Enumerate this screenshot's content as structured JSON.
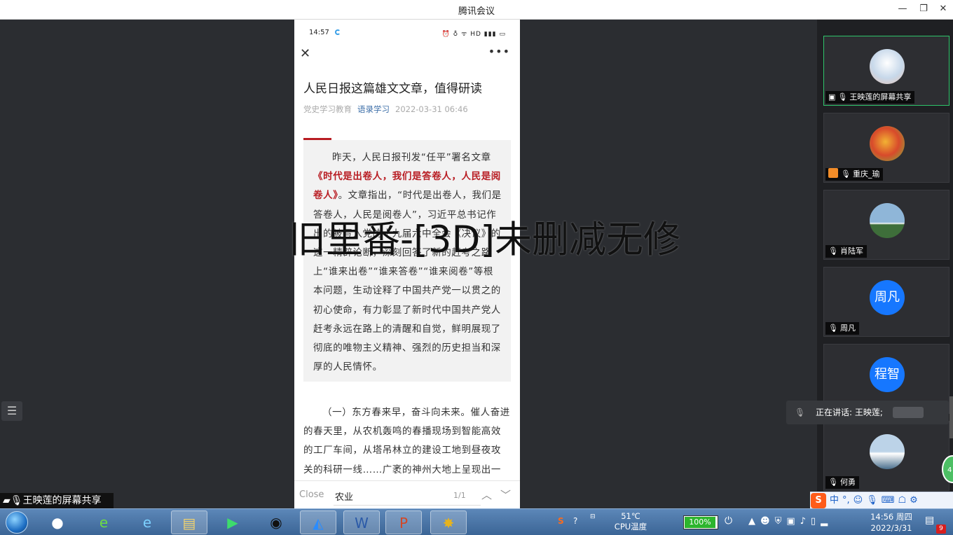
{
  "window": {
    "title": "腾讯会议"
  },
  "phone": {
    "status_time": "14:57",
    "status_icons": "⏰ ♁ ᯤ HD ▮▮▮ ▭",
    "article_title": "人民日报这篇雄文文章，值得研读",
    "meta_source": "党史学习教育",
    "meta_tag": "语录学习",
    "meta_date": "2022-03-31 06:46",
    "quote_intro": "昨天，人民日报刊发“任平”署名文章",
    "quote_red": "《时代是出卷人，我们是答卷人，人民是阅卷人》",
    "quote_rest": "。文章指出，“时代是出卷人，我们是答卷人，人民是阅卷人”，习近平总书记作出的被写入党的十九届六中全会《决议》的这一精辟论断，深刻回答了新的赶考之路上“谁来出卷”“谁来答卷”“谁来阅卷”等根本问题，生动诠释了中国共产党一以贯之的初心使命，有力彰显了新时代中国共产党人赶考永远在路上的清醒和自觉，鲜明展现了彻底的唯物主义精神、强烈的历史担当和深厚的人民情怀。",
    "body_text": "（一）东方春来早，奋斗向未来。催人奋进的春天里，从农机轰鸣的春播现场到智能高效的工厂车间，从塔吊林立的建设工地到昼夜攻关的科研一线……广袤的神州大地上呈现出一",
    "find_close": "Close",
    "find_query": "农业",
    "find_count": "1/1"
  },
  "watermark": "旧里番-[3D]未删减无修",
  "share_label": "王映莲的屏幕共享",
  "participants": [
    {
      "name": "王映莲的屏幕共享",
      "type": "photo",
      "colors": [
        "#c7d8ea",
        "#e9c4b4"
      ]
    },
    {
      "name": "重庆_瑜",
      "type": "photo",
      "colors": [
        "#d84a2b",
        "#7ab43c"
      ]
    },
    {
      "name": "肖陆军",
      "type": "photo",
      "colors": [
        "#8fb6d8",
        "#3e6e3a"
      ]
    },
    {
      "name": "周凡",
      "type": "text",
      "initials": "周凡"
    },
    {
      "name": "程智",
      "type": "text",
      "initials": "程智"
    },
    {
      "name": "何勇",
      "type": "photo",
      "colors": [
        "#bcd3e8",
        "#4a6f8d"
      ]
    }
  ],
  "speaking": {
    "label": "正在讲话: 王映莲;"
  },
  "ime": {
    "logo": "S",
    "lang": "中",
    "punct": "°,"
  },
  "taskbar": {
    "temp": "51℃",
    "temp_label": "CPU温度",
    "battery": "100%",
    "time": "14:56 周四",
    "date": "2022/3/31",
    "notif_count": "9"
  },
  "colors": {
    "accent_red": "#b81c22",
    "speaker_border": "#2ec46a",
    "avatar_blue": "#1677ff"
  }
}
